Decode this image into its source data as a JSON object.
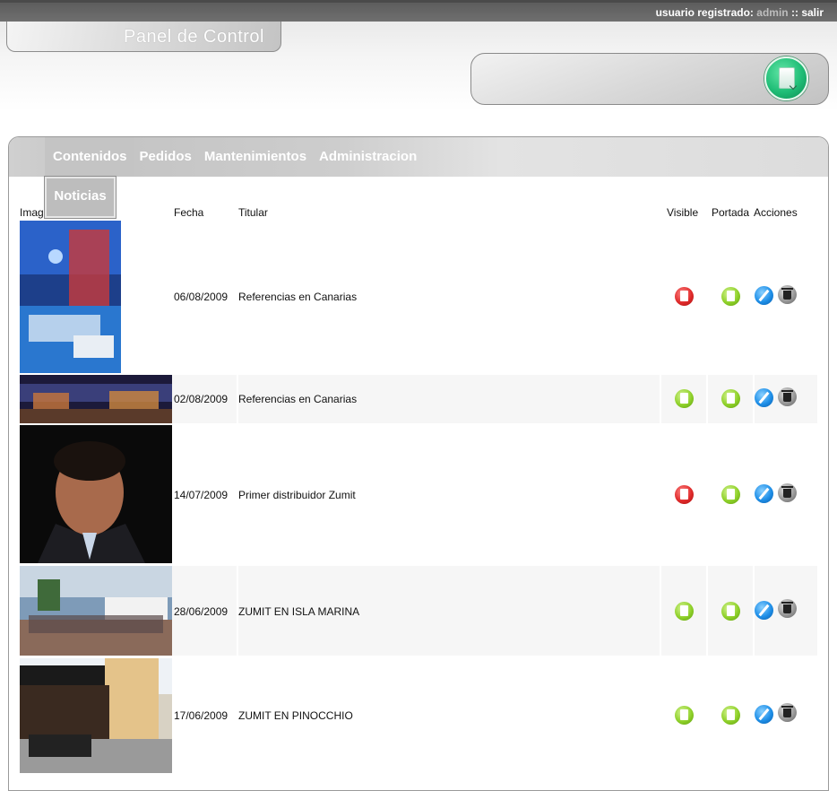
{
  "topbar": {
    "user_label": "usuario registrado:",
    "user_name": "admin",
    "separator": "::",
    "logout": "salir"
  },
  "header": {
    "title": "Panel de Control"
  },
  "nav": {
    "items": [
      "Contenidos",
      "Pedidos",
      "Mantenimientos",
      "Administracion"
    ],
    "active": "Contenidos"
  },
  "subnav": {
    "active": "Noticias"
  },
  "table": {
    "headers": {
      "image": "Imagen",
      "date": "Fecha",
      "title": "Titular",
      "visible": "Visible",
      "portada": "Portada",
      "actions": "Acciones"
    },
    "rows": [
      {
        "date": "06/08/2009",
        "title": "Referencias en Canarias",
        "visible": "no",
        "portada": "yes"
      },
      {
        "date": "02/08/2009",
        "title": "Referencias en Canarias",
        "visible": "yes",
        "portada": "yes"
      },
      {
        "date": "14/07/2009",
        "title": "Primer distribuidor Zumit",
        "visible": "no",
        "portada": "yes"
      },
      {
        "date": "28/06/2009",
        "title": "ZUMIT EN ISLA MARINA",
        "visible": "yes",
        "portada": "yes"
      },
      {
        "date": "17/06/2009",
        "title": "ZUMIT EN PINOCCHIO",
        "visible": "yes",
        "portada": "yes"
      }
    ]
  },
  "colors": {
    "topbar": "#666666",
    "nav_band": "#cfcfcf",
    "visible_off": "#e02b2b",
    "visible_on": "#8fd12a",
    "edit": "#1e8fe8",
    "delete": "#9a9a9a"
  }
}
